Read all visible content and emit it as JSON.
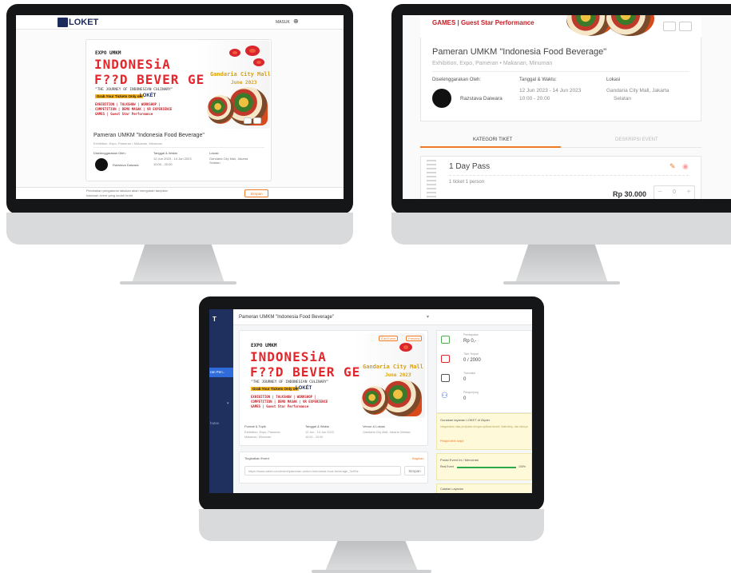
{
  "monitor1": {
    "header": {
      "logo": "LOKET",
      "nav": "MASUK"
    },
    "banner": {
      "expo": "EXPO UMKM",
      "indonesia": "INDONESiA",
      "food": "F??D BEVER GE",
      "journey": "\"THE JOURNEY OF INDONESIAN CULINARY\"",
      "grab": "Grab Your Tickets Only on",
      "loket": "LOKÉT",
      "line1": "EXHIBITION | TALKSHOW | WORKSHOP |",
      "line2": "COMPETITION | DEMO MASAK | VR EXPERIENCE",
      "line3": "GAMES | Guest Star Performance",
      "venue": "Gandaria City Mall",
      "date": "June 2023"
    },
    "title": "Pameran UMKM \"Indonesia Food Beverage\"",
    "category": "Exhibition, Expo, Pameran  •  Makanan, Minuman",
    "organizer_label": "Diselenggarakan Oleh:",
    "organizer_name": "Razstava Daiwara",
    "datetime_label": "Tanggal & Waktu",
    "date_range": "12 Jun 2023 - 14 Jun 2023",
    "time_range": "10:00 - 20:00",
    "location_label": "Lokasi",
    "location": "Gandaria City Mall, Jakarta Selatan",
    "footer_note": "Perubahan pengaturan lakukan akan mengubah tampilan",
    "footer_note2": "halaman event yang sudah terbit",
    "footer_button": "Simpan"
  },
  "monitor2": {
    "banner_line": "GAMES | Guest Star Performance",
    "title": "Pameran UMKM \"Indonesia Food Beverage\"",
    "category": "Exhibition, Expo, Pameran  •  Makanan, Minuman",
    "organizer_label": "Diselenggarakan Oleh:",
    "organizer_name": "Razstava Daiwara",
    "datetime_label": "Tanggal & Waktu:",
    "date_range": "12 Jun 2023 - 14 Jun 2023",
    "time_range": "10:00 - 20:00",
    "location_label": "Lokasi",
    "location_line1": "Gandaria City Mall, Jakarta",
    "location_line2": "Selatan",
    "tab_ticket": "KATEGORI TIKET",
    "tab_desc": "DESKRIPSI EVENT",
    "ticket_name": "1 Day Pass",
    "ticket_desc": "1 ticket 1 person",
    "price": "Rp 30.000",
    "qty": "0"
  },
  "monitor3": {
    "sidebar_logo": "T",
    "sidebar_items": [
      "ran Pen..",
      "hatan"
    ],
    "topbar_title": "Pameran UMKM \"Indonesia Food Beverage\"",
    "btn_edit": "Edit Event",
    "btn_preview": "Preview",
    "format_label": "Format & Topik",
    "format_val1": "Exhibition, Expo, Pameran",
    "format_val2": "Makanan, Minuman",
    "date_label": "Tanggal & Waktu",
    "date_val1": "12 Jun - 14 Jun 2023",
    "date_val2": "10:00 - 20:00",
    "venue_label": "Venue & Lokasi",
    "venue_val": "Gandaria City Mall, Jakarta Selatan",
    "link_label": "Tingkatkan Event",
    "link_action": "Bagikan",
    "link_url": "https://www.loket.com/event/pameran-umkm-indonesia-food-beverage_3cS9z",
    "link_button": "Simpan",
    "stats": [
      {
        "label": "Pendapatan",
        "value": "Rp 0,-"
      },
      {
        "label": "Tiket Terjual",
        "value": "0 / 2000"
      },
      {
        "label": "Transaksi",
        "value": "0"
      },
      {
        "label": "Pengunjung",
        "value": "0"
      }
    ],
    "promo_title": "Gunakan layanan LOKET di Zapier",
    "promo_body": "Integrasikan data penjualan dengan aplikasi favorit, Mailchimp, dan lainnya",
    "promo_link": "Pelajari lebih lanjut",
    "progress_title": "Posisi Event Ini / Mencintai",
    "progress_label": "Real Event",
    "progress_value": "100%",
    "progress_fraction": 1.0,
    "bottom_label": "Catatan Layanan"
  },
  "colors": {
    "accent": "#f07a24",
    "brand_red": "#e3262b",
    "sidebar": "#1f2f5e",
    "promo_bg": "#fdf9d9"
  }
}
